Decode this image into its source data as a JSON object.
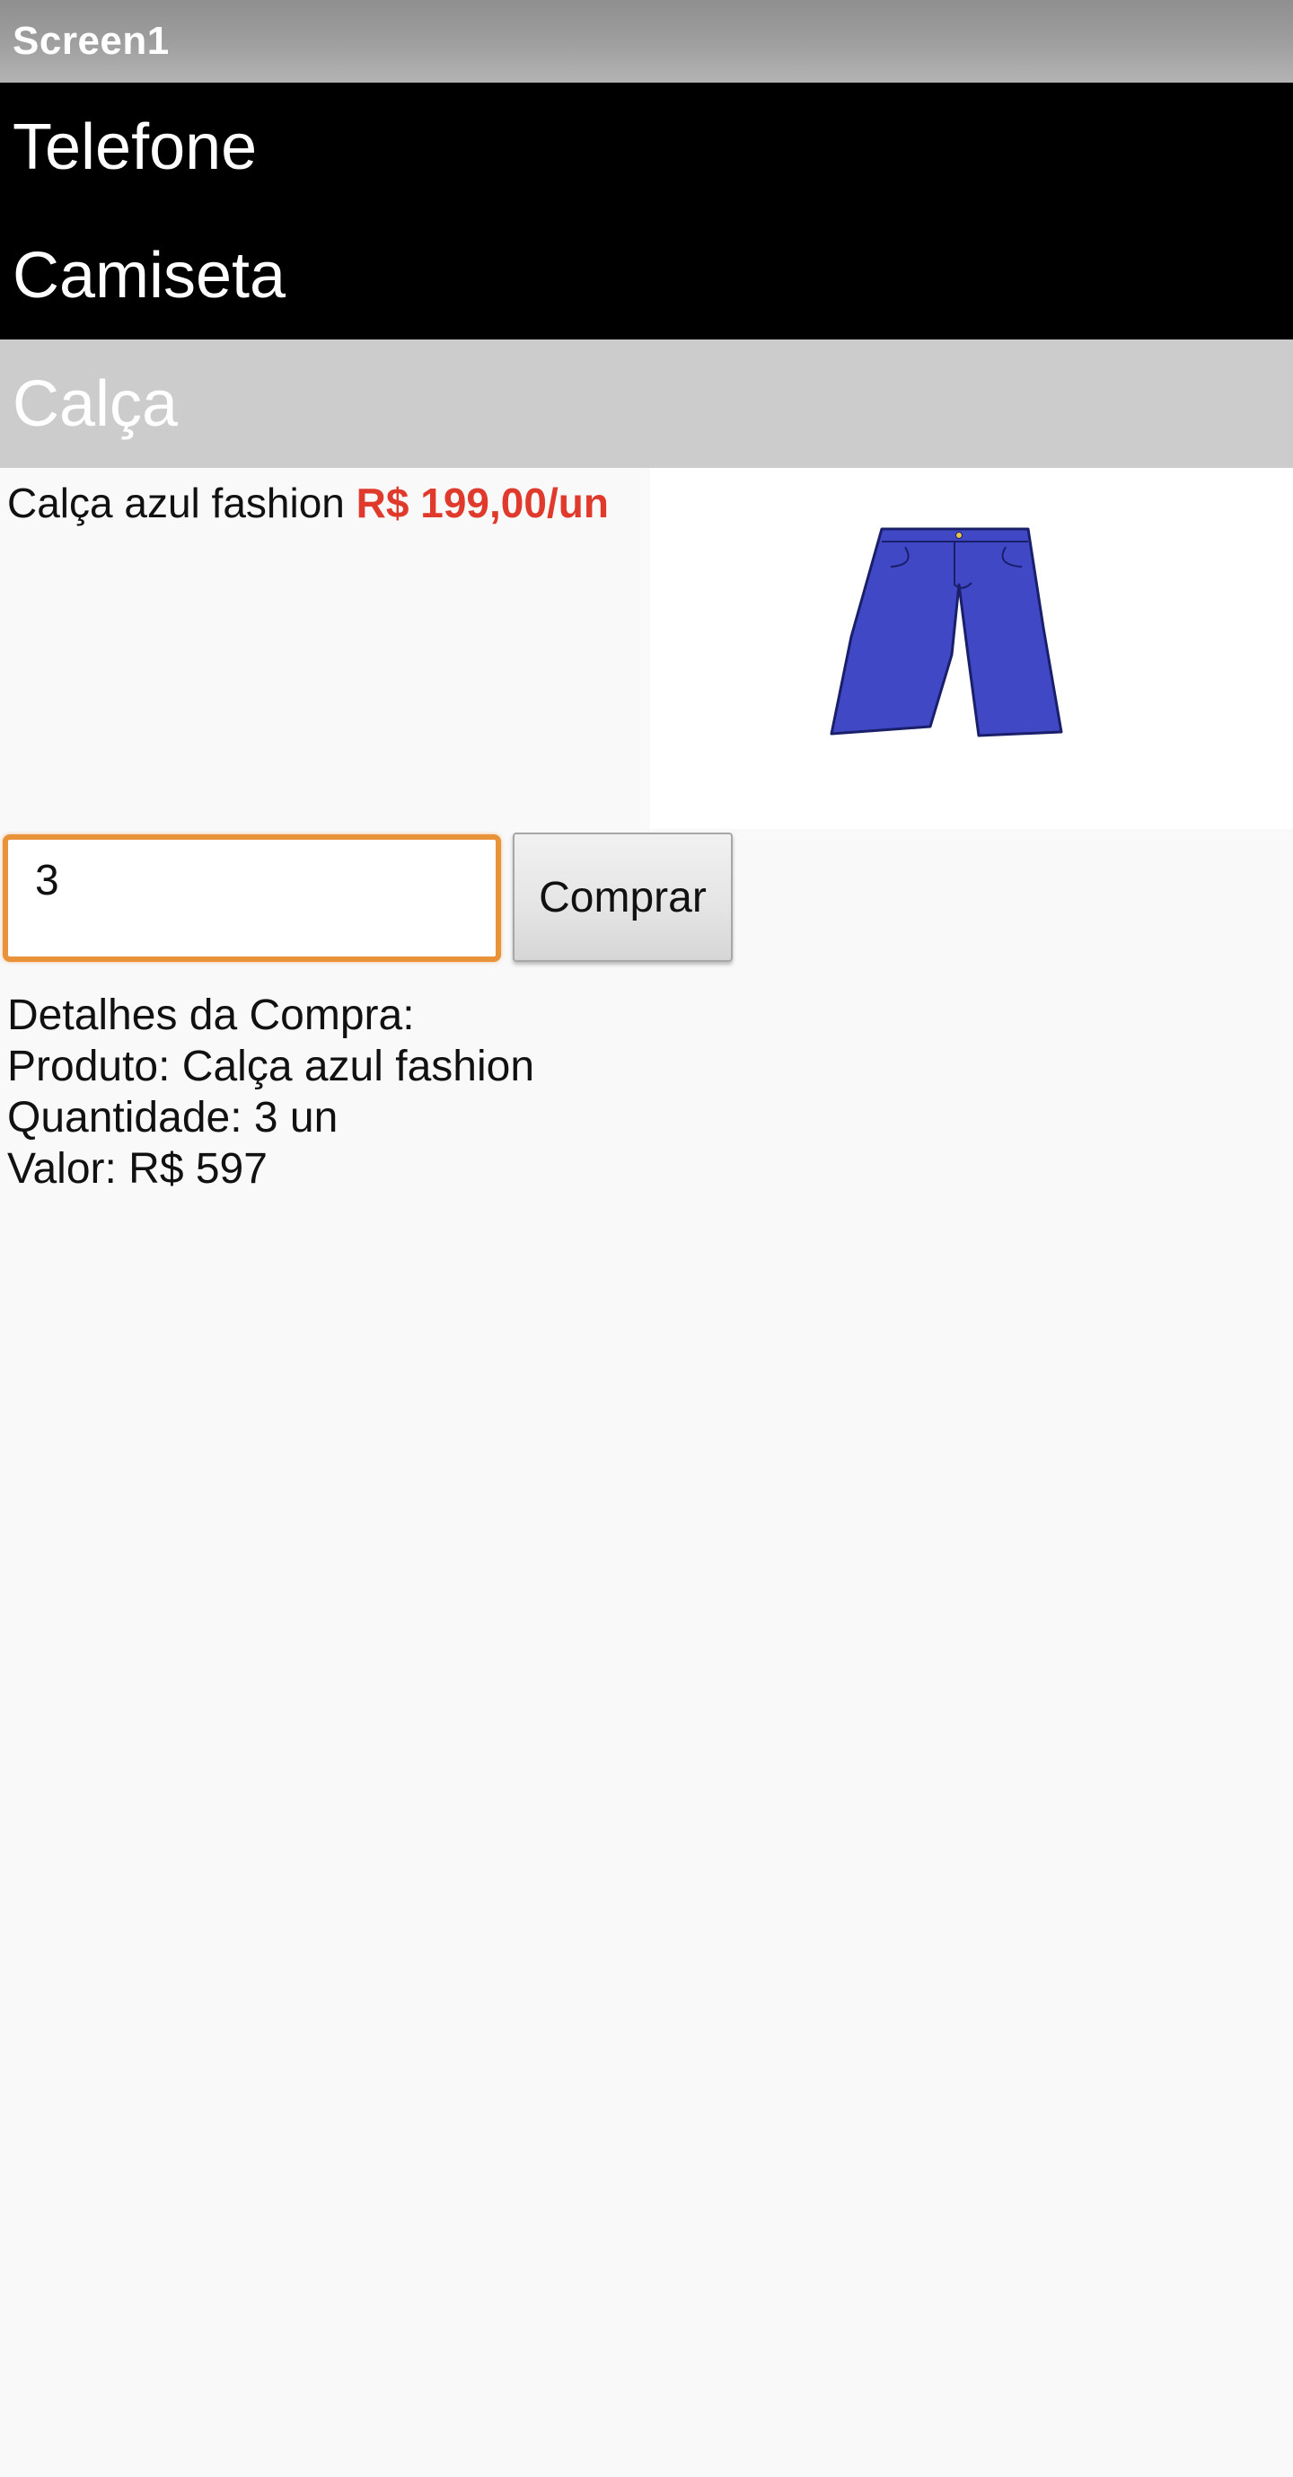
{
  "window": {
    "title": "Screen1"
  },
  "categories": [
    {
      "label": "Telefone"
    },
    {
      "label": "Camiseta"
    },
    {
      "label": "Calça"
    }
  ],
  "product": {
    "name": "Calça azul fashion",
    "price": "R$ 199,00/un",
    "price_color": "#e03a2c",
    "image": "blue-jeans-image"
  },
  "purchase": {
    "quantity_value": "3",
    "quantity_border_color": "#e8923a",
    "buy_label": "Comprar"
  },
  "details": {
    "heading": "Detalhes da Compra:",
    "product_line": "Produto: Calça azul fashion",
    "quantity_line": "Quantidade: 3 un",
    "value_line": "Valor: R$ 597"
  }
}
